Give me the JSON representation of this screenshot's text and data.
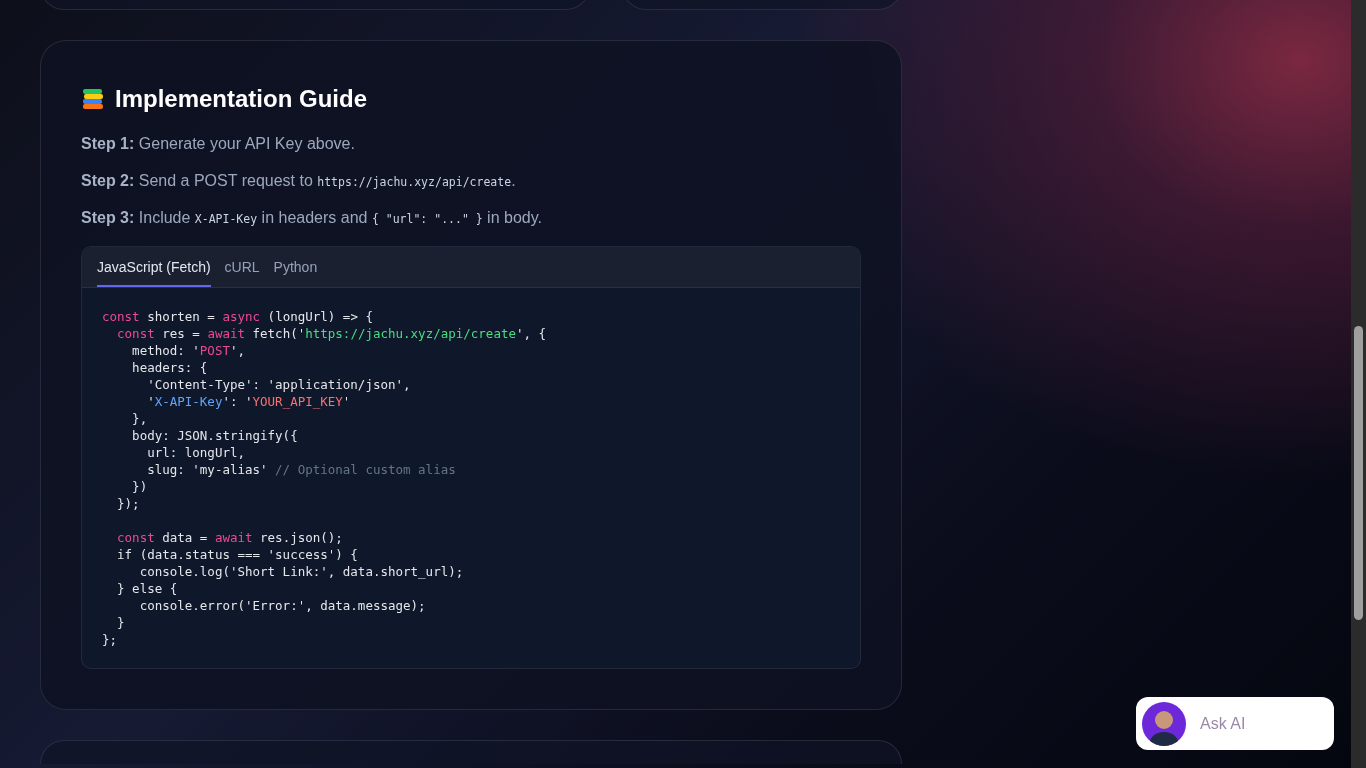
{
  "guide": {
    "title": "Implementation Guide",
    "steps": [
      {
        "label": "Step 1:",
        "parts": [
          {
            "kind": "text",
            "text": " Generate your API Key above."
          }
        ]
      },
      {
        "label": "Step 2:",
        "parts": [
          {
            "kind": "text",
            "text": " Send a POST request to "
          },
          {
            "kind": "code",
            "text": "https://jachu.xyz/api/create"
          },
          {
            "kind": "text",
            "text": "."
          }
        ]
      },
      {
        "label": "Step 3:",
        "parts": [
          {
            "kind": "text",
            "text": " Include "
          },
          {
            "kind": "code",
            "text": "X-API-Key"
          },
          {
            "kind": "text",
            "text": " in headers and "
          },
          {
            "kind": "code",
            "text": "{ \"url\": \"...\" }"
          },
          {
            "kind": "text",
            "text": " in body."
          }
        ]
      }
    ],
    "tabs": [
      {
        "label": "JavaScript (Fetch)",
        "selected": true
      },
      {
        "label": "cURL",
        "selected": false
      },
      {
        "label": "Python",
        "selected": false
      }
    ],
    "code": [
      {
        "kind": "code",
        "tokens": [
          {
            "kind": "keyword",
            "text": "const"
          },
          {
            "kind": "plain",
            "text": " shorten = "
          },
          {
            "kind": "keyword",
            "text": "async"
          },
          {
            "kind": "plain",
            "text": " (longUrl) => {"
          }
        ]
      },
      {
        "kind": "code",
        "tokens": [
          {
            "kind": "keyword",
            "text": "  const"
          },
          {
            "kind": "plain",
            "text": " res = "
          },
          {
            "kind": "keyword",
            "text": "await"
          },
          {
            "kind": "plain",
            "text": " fetch('"
          },
          {
            "kind": "url",
            "text": "https://jachu.xyz/api/create"
          },
          {
            "kind": "plain",
            "text": "', {"
          }
        ]
      },
      {
        "kind": "code",
        "tokens": [
          {
            "kind": "plain",
            "text": "    method: '"
          },
          {
            "kind": "keyword",
            "text": "POST"
          },
          {
            "kind": "plain",
            "text": "',"
          }
        ]
      },
      {
        "kind": "code",
        "tokens": [
          {
            "kind": "plain",
            "text": "    headers: {"
          }
        ]
      },
      {
        "kind": "code",
        "tokens": [
          {
            "kind": "plain",
            "text": "      'Content-Type': 'application/json',"
          }
        ]
      },
      {
        "kind": "code",
        "tokens": [
          {
            "kind": "plain",
            "text": "      '"
          },
          {
            "kind": "header",
            "text": "X-API-Key"
          },
          {
            "kind": "plain",
            "text": "': '"
          },
          {
            "kind": "value",
            "text": "YOUR_API_KEY"
          },
          {
            "kind": "plain",
            "text": "'"
          }
        ]
      },
      {
        "kind": "code",
        "tokens": [
          {
            "kind": "plain",
            "text": "    },"
          }
        ]
      },
      {
        "kind": "code",
        "tokens": [
          {
            "kind": "plain",
            "text": "    body: JSON.stringify({"
          }
        ]
      },
      {
        "kind": "code",
        "tokens": [
          {
            "kind": "plain",
            "text": "      url: longUrl,"
          }
        ]
      },
      {
        "kind": "code",
        "tokens": [
          {
            "kind": "plain",
            "text": "      slug: 'my-alias' "
          },
          {
            "kind": "comment",
            "text": "// Optional custom alias"
          }
        ]
      },
      {
        "kind": "code",
        "tokens": [
          {
            "kind": "plain",
            "text": "    })"
          }
        ]
      },
      {
        "kind": "code",
        "tokens": [
          {
            "kind": "plain",
            "text": "  });"
          }
        ]
      },
      {
        "kind": "blank"
      },
      {
        "kind": "code",
        "tokens": [
          {
            "kind": "keyword",
            "text": "  const"
          },
          {
            "kind": "plain",
            "text": " data = "
          },
          {
            "kind": "keyword",
            "text": "await"
          },
          {
            "kind": "plain",
            "text": " res.json();"
          }
        ]
      },
      {
        "kind": "code",
        "tokens": [
          {
            "kind": "plain",
            "text": "  if (data.status === 'success') {"
          }
        ]
      },
      {
        "kind": "code",
        "tokens": [
          {
            "kind": "plain",
            "text": "     console.log('Short Link:', data.short_url);"
          }
        ]
      },
      {
        "kind": "code",
        "tokens": [
          {
            "kind": "plain",
            "text": "  } else {"
          }
        ]
      },
      {
        "kind": "code",
        "tokens": [
          {
            "kind": "plain",
            "text": "     console.error('Error:', data.message);"
          }
        ]
      },
      {
        "kind": "code",
        "tokens": [
          {
            "kind": "plain",
            "text": "  }"
          }
        ]
      },
      {
        "kind": "code",
        "tokens": [
          {
            "kind": "plain",
            "text": "};"
          }
        ]
      }
    ]
  },
  "chat_widget": {
    "placeholder": "Ask AI"
  }
}
